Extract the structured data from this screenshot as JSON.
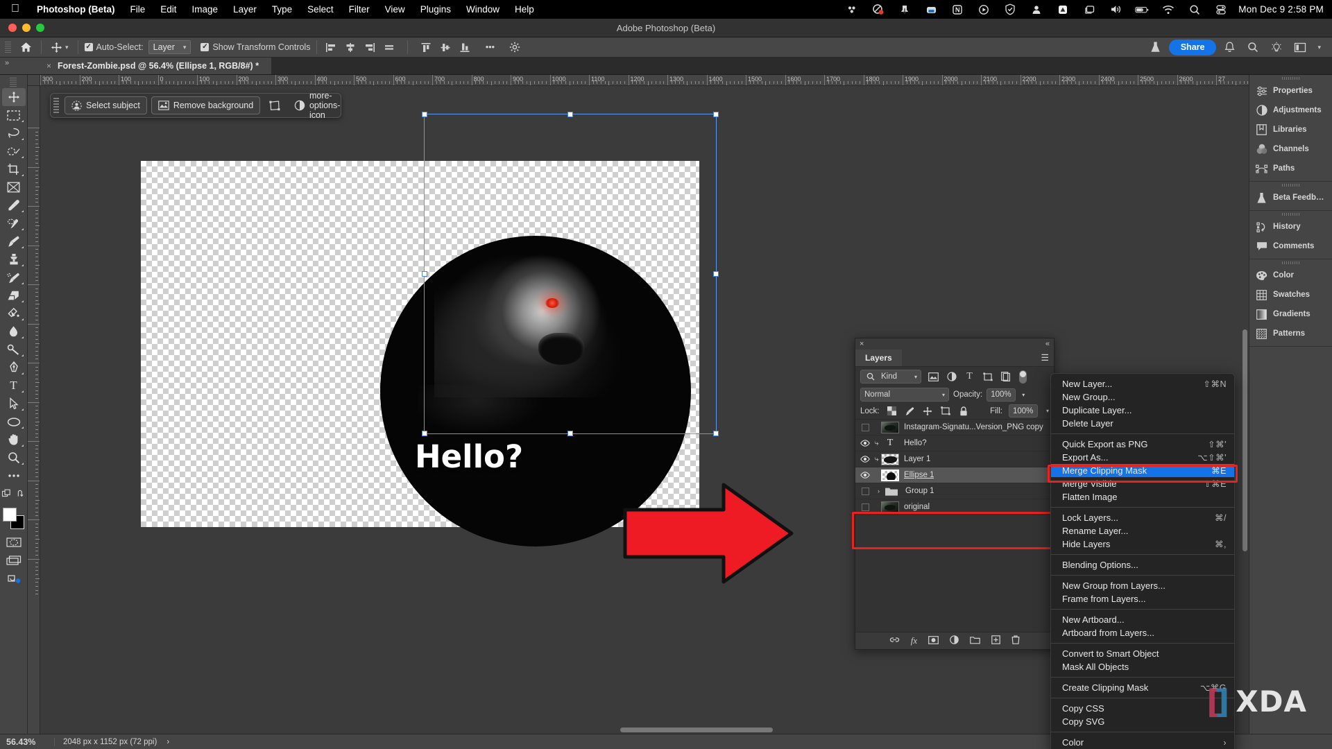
{
  "menubar": {
    "apple_icon": "apple-logo-icon",
    "app_name": "Photoshop (Beta)",
    "items": [
      "File",
      "Edit",
      "Image",
      "Layer",
      "Type",
      "Select",
      "Filter",
      "View",
      "Plugins",
      "Window",
      "Help"
    ],
    "tray_icons": [
      "dropbox-icon",
      "cleanmymac-icon",
      "stats-icon",
      "backup-icon",
      "notion-icon",
      "iina-icon",
      "adguard-icon",
      "user-icon",
      "drive-icon",
      "displays-icon",
      "volume-icon",
      "battery-icon",
      "wifi-icon",
      "spotlight-search-icon",
      "control-center-icon"
    ],
    "clock": "Mon Dec 9  2:58 PM"
  },
  "window": {
    "title": "Adobe Photoshop (Beta)"
  },
  "options_bar": {
    "home_icon": "home-icon",
    "tool_icon": "move-tool-icon",
    "auto_select_label": "Auto-Select:",
    "auto_select_checked": true,
    "auto_select_value": "Layer",
    "show_transform_label": "Show Transform Controls",
    "show_transform_checked": true,
    "align_icons": [
      "align-left-edges-icon",
      "align-horizontal-centers-icon",
      "align-right-edges-icon",
      "distribute-horizontally-icon",
      "align-top-edges-icon",
      "align-vertical-centers-icon",
      "align-bottom-edges-icon"
    ],
    "more_label": "•••",
    "gear_icon": "gear-icon",
    "beta_flask_icon": "beta-flask-icon",
    "share_label": "Share",
    "bell_icon": "bell-icon",
    "search_icon": "search-icon",
    "discover_icon": "lightbulb-icon",
    "workspace_icon": "workspace-switcher-icon",
    "chevron_icon": "chevron-down-icon"
  },
  "tab_bar": {
    "expand_icon": "expand-panels-icon",
    "close_icon": "close-icon",
    "document_title": "Forest-Zombie.psd @ 56.4% (Ellipse 1, RGB/8#) *"
  },
  "toolbar": {
    "tools": [
      {
        "name": "move-tool-icon",
        "active": true,
        "corner": false
      },
      {
        "name": "rectangular-marquee-tool-icon",
        "active": false,
        "corner": true
      },
      {
        "name": "lasso-tool-icon",
        "active": false,
        "corner": true
      },
      {
        "name": "object-selection-tool-icon",
        "active": false,
        "corner": true
      },
      {
        "name": "crop-tool-icon",
        "active": false,
        "corner": true
      },
      {
        "name": "frame-tool-icon",
        "active": false,
        "corner": false
      },
      {
        "name": "eyedropper-tool-icon",
        "active": false,
        "corner": true
      },
      {
        "name": "spot-healing-brush-tool-icon",
        "active": false,
        "corner": true
      },
      {
        "name": "brush-tool-icon",
        "active": false,
        "corner": true
      },
      {
        "name": "clone-stamp-tool-icon",
        "active": false,
        "corner": true
      },
      {
        "name": "history-brush-tool-icon",
        "active": false,
        "corner": true
      },
      {
        "name": "eraser-tool-icon",
        "active": false,
        "corner": true
      },
      {
        "name": "gradient-tool-icon",
        "active": false,
        "corner": true
      },
      {
        "name": "blur-tool-icon",
        "active": false,
        "corner": true
      },
      {
        "name": "dodge-tool-icon",
        "active": false,
        "corner": true
      },
      {
        "name": "pen-tool-icon",
        "active": false,
        "corner": true
      },
      {
        "name": "path-selection-tool-icon",
        "active": false,
        "corner": true
      },
      {
        "name": "type-tool-icon",
        "active": false,
        "corner": true
      },
      {
        "name": "direct-selection-tool-icon",
        "active": false,
        "corner": true
      },
      {
        "name": "ellipse-tool-icon",
        "active": false,
        "corner": true
      },
      {
        "name": "hand-tool-icon",
        "active": false,
        "corner": true
      },
      {
        "name": "zoom-tool-icon",
        "active": false,
        "corner": true
      },
      {
        "name": "edit-toolbar-icon",
        "active": false,
        "corner": false
      }
    ],
    "foreground_color": "#ffffff",
    "background_color": "#000000",
    "quickmask_icon": "quick-mask-mode-icon",
    "screenmode_icon": "screen-mode-icon",
    "cloud_icon": "cloud-documents-icon"
  },
  "contextual_task_bar": {
    "select_subject_label": "Select subject",
    "select_subject_icon": "select-subject-icon",
    "remove_background_label": "Remove background",
    "remove_background_icon": "remove-background-icon",
    "transform_icon": "transform-icon",
    "adjustment_icon": "adjustment-layer-icon",
    "more_icon": "more-options-icon"
  },
  "rulers": {
    "horizontal_labels": [
      "300",
      "200",
      "100",
      "0",
      "100",
      "200",
      "300",
      "400",
      "500",
      "600",
      "700",
      "800",
      "900",
      "1000",
      "1100",
      "1200",
      "1300",
      "1400",
      "1500",
      "1600",
      "1700",
      "1800",
      "1900",
      "2000",
      "2100",
      "2200",
      "2300",
      "2400",
      "2500",
      "2600",
      "27"
    ],
    "vertical_labels": [
      "0",
      "100",
      "200",
      "300",
      "400",
      "500",
      "600",
      "700",
      "800",
      "900",
      "1000",
      "1100"
    ]
  },
  "canvas": {
    "hello_text": "Hello?",
    "arrow_color": "#ee1b24",
    "eye_color": "#ff3c1e"
  },
  "dock": {
    "groups": [
      {
        "items": [
          {
            "label": "Properties",
            "icon": "properties-icon"
          },
          {
            "label": "Adjustments",
            "icon": "adjustments-icon"
          },
          {
            "label": "Libraries",
            "icon": "libraries-icon"
          },
          {
            "label": "Channels",
            "icon": "channels-icon"
          },
          {
            "label": "Paths",
            "icon": "paths-icon"
          }
        ]
      },
      {
        "items": [
          {
            "label": "Beta Feedb…",
            "icon": "beta-flask-icon"
          }
        ]
      },
      {
        "items": [
          {
            "label": "History",
            "icon": "history-icon"
          },
          {
            "label": "Comments",
            "icon": "comments-icon"
          }
        ]
      },
      {
        "items": [
          {
            "label": "Color",
            "icon": "color-palette-icon"
          },
          {
            "label": "Swatches",
            "icon": "swatches-icon"
          },
          {
            "label": "Gradients",
            "icon": "gradients-icon"
          },
          {
            "label": "Patterns",
            "icon": "patterns-icon"
          }
        ]
      }
    ]
  },
  "layers_panel": {
    "close_icon": "close-icon",
    "collapse_icon": "collapse-panel-icon",
    "tab_label": "Layers",
    "menu_icon": "panel-menu-icon",
    "filter": {
      "search_icon": "search-icon",
      "kind_label": "Kind",
      "chevron_icon": "chevron-down-icon",
      "filter_icons": [
        "filter-pixel-icon",
        "filter-adjustment-icon",
        "filter-type-icon",
        "filter-shape-icon",
        "filter-smart-object-icon"
      ],
      "toggle_on": true
    },
    "blend_mode": "Normal",
    "opacity_label": "Opacity:",
    "opacity_value": "100%",
    "lock_label": "Lock:",
    "lock_icons": [
      "lock-transparent-pixels-icon",
      "lock-image-pixels-icon",
      "lock-position-icon",
      "lock-artboard-nesting-icon",
      "lock-all-icon"
    ],
    "fill_label": "Fill:",
    "fill_value": "100%",
    "layers": [
      {
        "name": "Instagram-Signatu...Version_PNG copy",
        "visible": false,
        "clipped": false,
        "type": "image",
        "selected": false,
        "underline": false
      },
      {
        "name": "Hello?",
        "visible": true,
        "clipped": true,
        "type": "text",
        "selected": false,
        "underline": false
      },
      {
        "name": "Layer 1",
        "visible": true,
        "clipped": true,
        "type": "image",
        "selected": false,
        "underline": false
      },
      {
        "name": "Ellipse 1",
        "visible": true,
        "clipped": false,
        "type": "shape",
        "selected": true,
        "underline": true
      },
      {
        "name": "Group 1",
        "visible": false,
        "clipped": false,
        "type": "group",
        "selected": false,
        "underline": false
      },
      {
        "name": "original",
        "visible": false,
        "clipped": false,
        "type": "image",
        "selected": false,
        "underline": false
      }
    ],
    "footer_icons": [
      "link-layers-icon",
      "layer-styles-icon",
      "layer-mask-icon",
      "new-adjustment-layer-icon",
      "new-group-icon",
      "new-layer-icon",
      "delete-layer-icon"
    ]
  },
  "context_menu": {
    "sections": [
      [
        {
          "label": "New Layer...",
          "shortcut": "⇧⌘N",
          "highlighted": false
        },
        {
          "label": "New Group...",
          "shortcut": "",
          "highlighted": false
        },
        {
          "label": "Duplicate Layer...",
          "shortcut": "",
          "highlighted": false
        },
        {
          "label": "Delete Layer",
          "shortcut": "",
          "highlighted": false
        }
      ],
      [
        {
          "label": "Quick Export as PNG",
          "shortcut": "⇧⌘'",
          "highlighted": false
        },
        {
          "label": "Export As...",
          "shortcut": "⌥⇧⌘'",
          "highlighted": false
        },
        {
          "label": "Merge Clipping Mask",
          "shortcut": "⌘E",
          "highlighted": true
        },
        {
          "label": "Merge Visible",
          "shortcut": "⇧⌘E",
          "highlighted": false
        },
        {
          "label": "Flatten Image",
          "shortcut": "",
          "highlighted": false
        }
      ],
      [
        {
          "label": "Lock Layers...",
          "shortcut": "⌘/",
          "highlighted": false
        },
        {
          "label": "Rename Layer...",
          "shortcut": "",
          "highlighted": false
        },
        {
          "label": "Hide Layers",
          "shortcut": "⌘,",
          "highlighted": false
        }
      ],
      [
        {
          "label": "Blending Options...",
          "shortcut": "",
          "highlighted": false
        }
      ],
      [
        {
          "label": "New Group from Layers...",
          "shortcut": "",
          "highlighted": false
        },
        {
          "label": "Frame from Layers...",
          "shortcut": "",
          "highlighted": false
        }
      ],
      [
        {
          "label": "New Artboard...",
          "shortcut": "",
          "highlighted": false
        },
        {
          "label": "Artboard from Layers...",
          "shortcut": "",
          "highlighted": false
        }
      ],
      [
        {
          "label": "Convert to Smart Object",
          "shortcut": "",
          "highlighted": false
        },
        {
          "label": "Mask All Objects",
          "shortcut": "",
          "highlighted": false
        }
      ],
      [
        {
          "label": "Create Clipping Mask",
          "shortcut": "⌥⌘G",
          "highlighted": false
        }
      ],
      [
        {
          "label": "Copy CSS",
          "shortcut": "",
          "highlighted": false
        },
        {
          "label": "Copy SVG",
          "shortcut": "",
          "highlighted": false
        }
      ],
      [
        {
          "label": "Color",
          "shortcut": "›",
          "highlighted": false
        }
      ]
    ]
  },
  "status_bar": {
    "zoom": "56.43%",
    "doc_info": "2048 px x 1152 px (72 ppi)",
    "chevron": "›"
  },
  "watermark": {
    "text": "XDA",
    "bracket_left_color": "#b93856",
    "bracket_right_color": "#2e7fae"
  }
}
